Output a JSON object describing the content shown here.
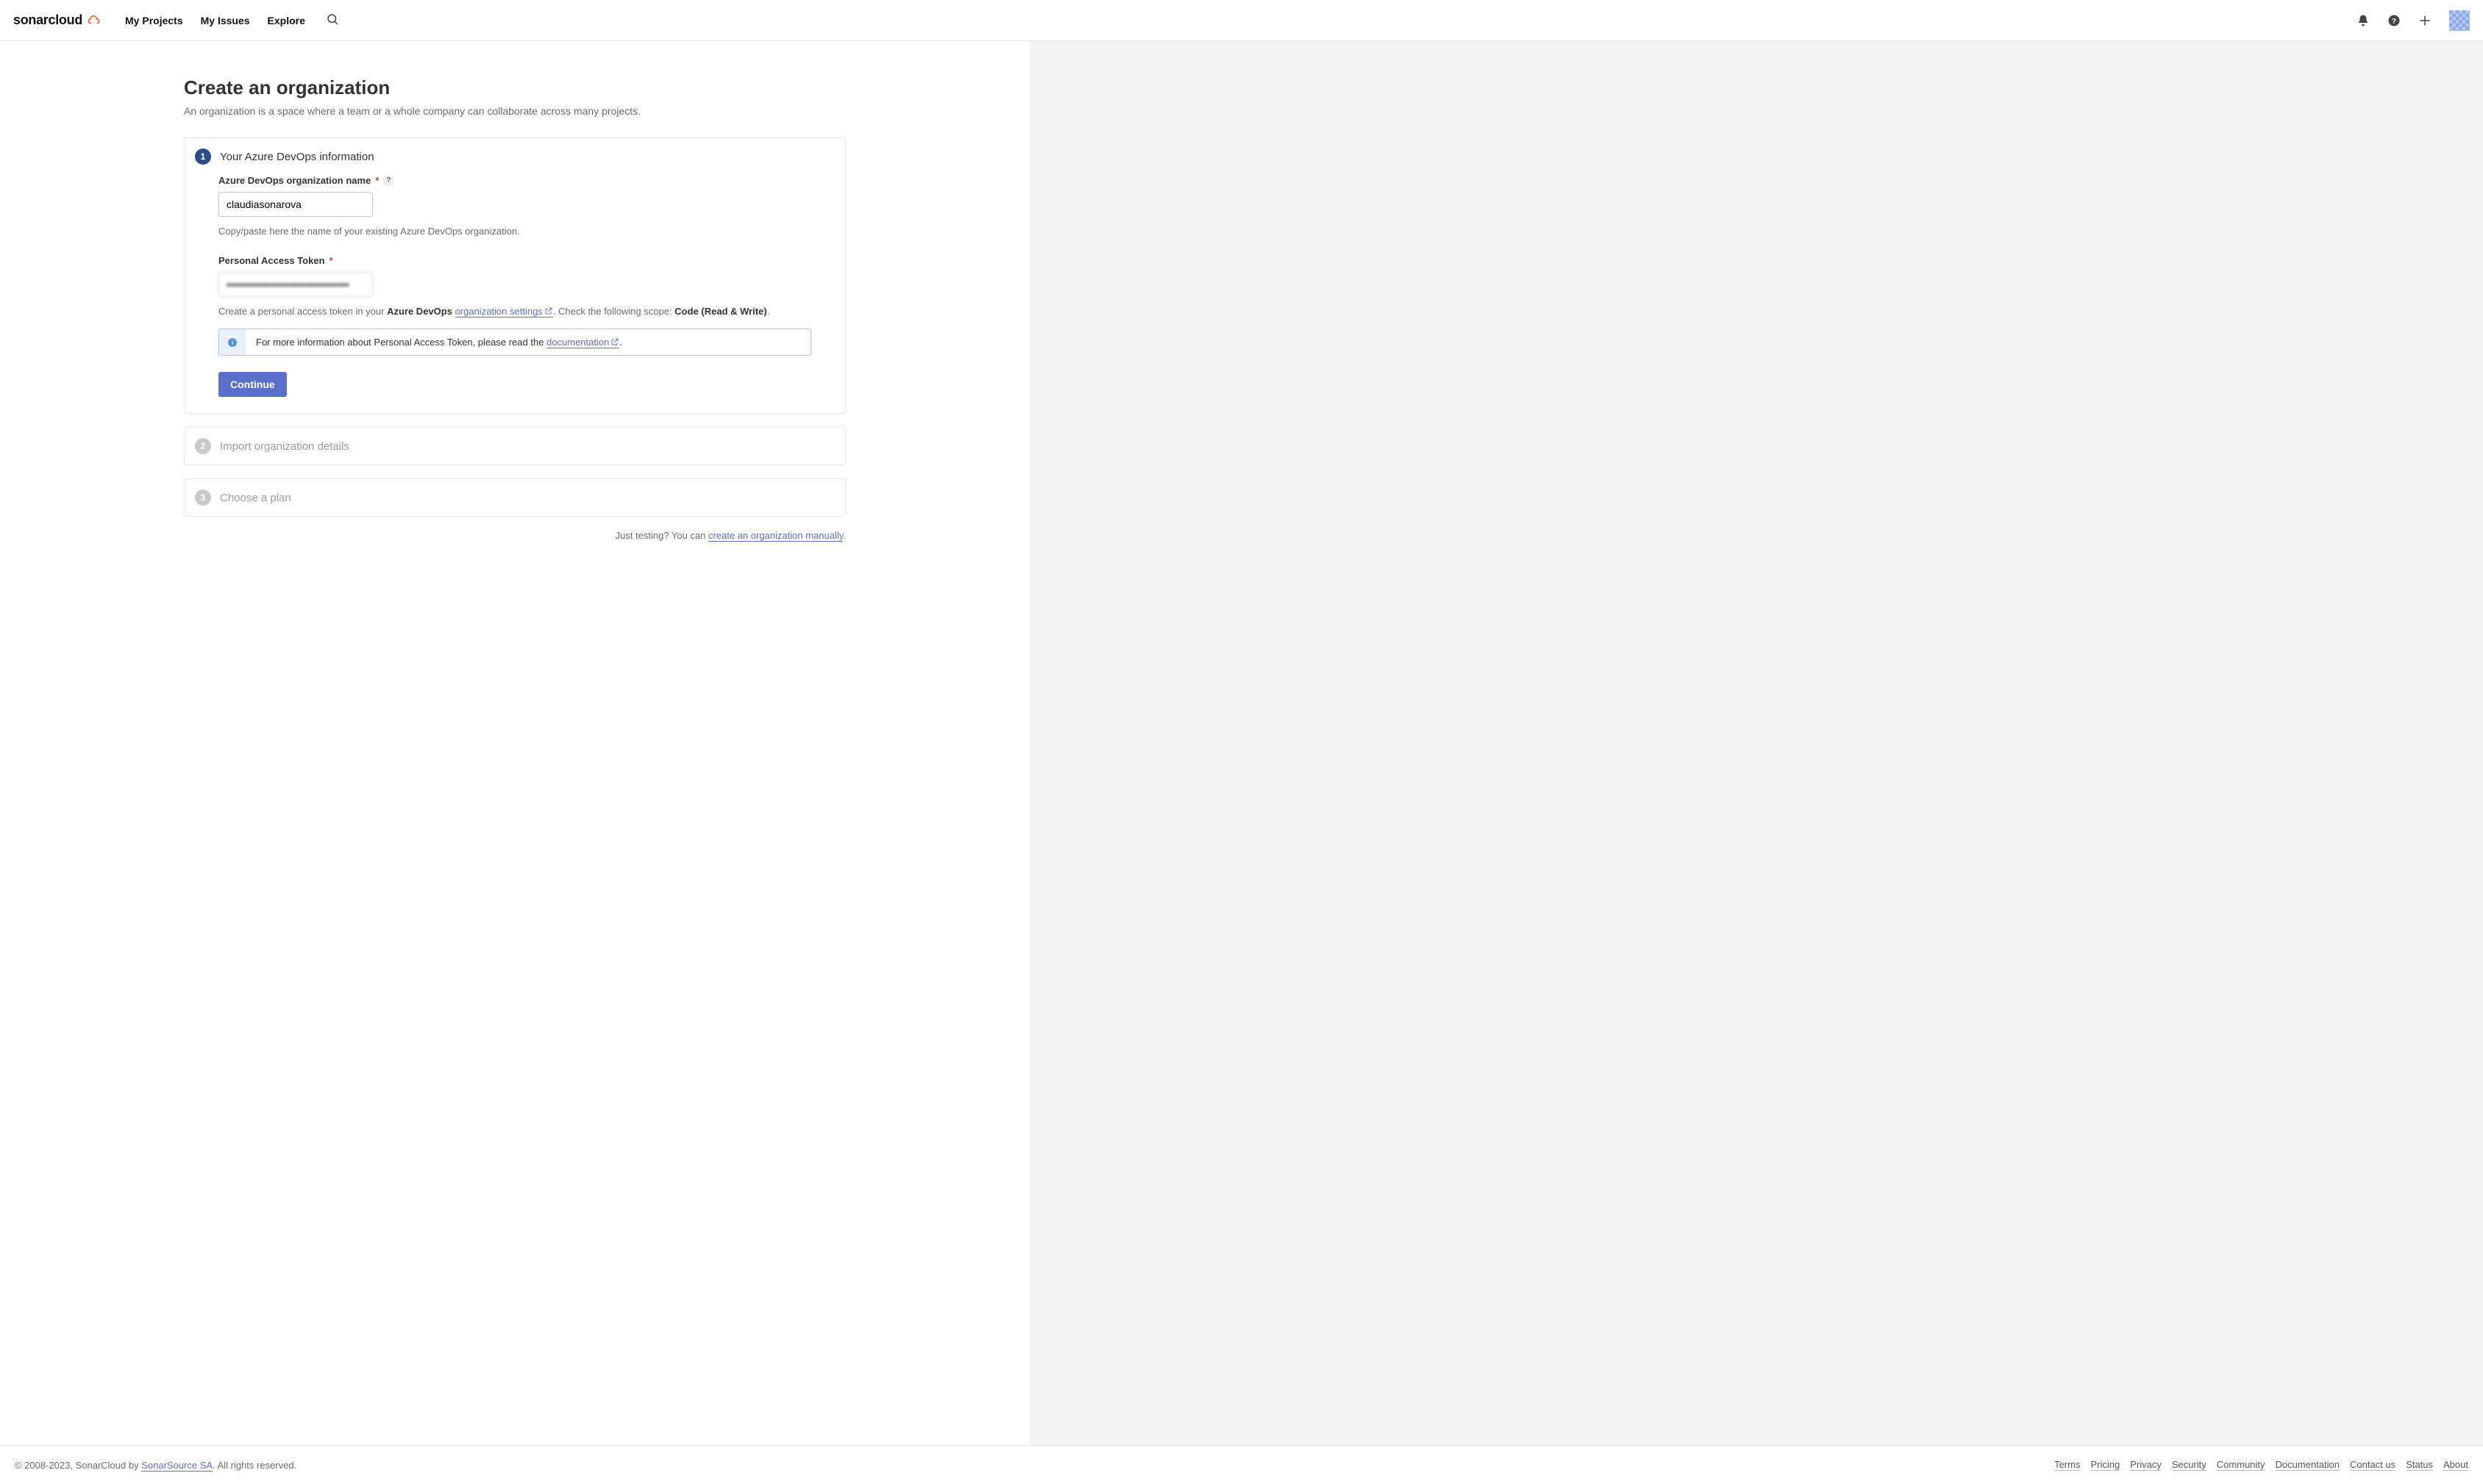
{
  "header": {
    "brand": "sonarcloud",
    "nav": {
      "my_projects": "My Projects",
      "my_issues": "My Issues",
      "explore": "Explore"
    }
  },
  "page": {
    "title": "Create an organization",
    "subtitle": "An organization is a space where a team or a whole company can collaborate across many projects."
  },
  "steps": {
    "s1": {
      "num": "1",
      "title": "Your Azure DevOps information",
      "org_name_label": "Azure DevOps organization name",
      "org_name_value": "claudiasonarova",
      "org_name_hint": "Copy/paste here the name of your existing Azure DevOps organization.",
      "pat_label": "Personal Access Token",
      "pat_value": "••••••••••••••••••••••••••••••••••",
      "pat_hint_pre": "Create a personal access token in your ",
      "pat_hint_bold": "Azure DevOps ",
      "pat_link": "organization settings",
      "pat_hint_mid": ". Check the following scope: ",
      "pat_scope": "Code (Read & Write)",
      "pat_hint_end": ".",
      "alert_pre": "For more information about Personal Access Token, please read the ",
      "alert_link": "documentation",
      "alert_end": ".",
      "continue": "Continue"
    },
    "s2": {
      "num": "2",
      "title": "Import organization details"
    },
    "s3": {
      "num": "3",
      "title": "Choose a plan"
    }
  },
  "manual_line": {
    "pre": "Just testing? You can ",
    "link": "create an organization manually",
    "end": "."
  },
  "footer": {
    "copyright_pre": "© 2008-2023, SonarCloud by ",
    "sonarsource": "SonarSource SA",
    "copyright_post": ". All rights reserved.",
    "links": {
      "terms": "Terms",
      "pricing": "Pricing",
      "privacy": "Privacy",
      "security": "Security",
      "community": "Community",
      "documentation": "Documentation",
      "contact": "Contact us",
      "status": "Status",
      "about": "About"
    }
  }
}
